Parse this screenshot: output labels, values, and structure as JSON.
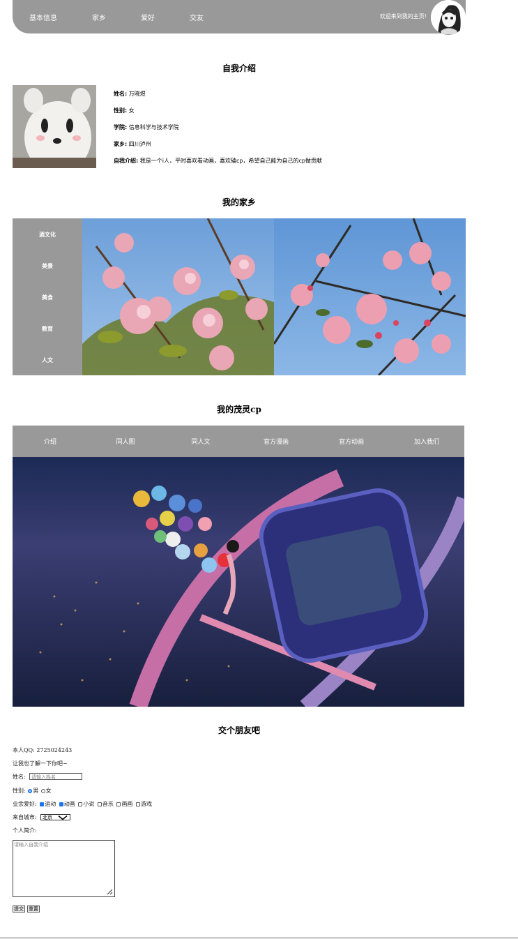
{
  "nav": {
    "links": [
      "基本信息",
      "家乡",
      "爱好",
      "交友"
    ],
    "welcome": "欢迎来到我的主页!"
  },
  "intro": {
    "title": "自我介绍",
    "rows": [
      {
        "label": "姓名:",
        "value": "万晓煜"
      },
      {
        "label": "性别:",
        "value": "女"
      },
      {
        "label": "学院:",
        "value": "信息科学与技术学院"
      },
      {
        "label": "家乡:",
        "value": "四川泸州"
      },
      {
        "label": "自我介绍:",
        "value": "我是一个i人，平时喜欢看动画，喜欢磕cp，希望自己能为自己的cp做贡献"
      }
    ]
  },
  "hometown": {
    "title": "我的家乡",
    "menu": [
      "酒文化",
      "美景",
      "美食",
      "教育",
      "人文"
    ]
  },
  "cp": {
    "title": "我的茂灵cp",
    "tabs": [
      "介绍",
      "同人图",
      "同人文",
      "官方漫画",
      "官方动画",
      "加入我们"
    ]
  },
  "friend": {
    "title": "交个朋友吧",
    "qq_label": "本人QQ:",
    "qq_value": "2725024243",
    "prompt": "让我也了解一下你吧~",
    "name_label": "姓名:",
    "name_placeholder": "请输入姓名",
    "gender_label": "性别:",
    "gender_options": [
      "男",
      "女"
    ],
    "gender_selected": "男",
    "hobby_label": "业余爱好:",
    "hobbies": [
      {
        "label": "运动",
        "checked": true
      },
      {
        "label": "动画",
        "checked": true
      },
      {
        "label": "小说",
        "checked": false
      },
      {
        "label": "音乐",
        "checked": false
      },
      {
        "label": "画画",
        "checked": false
      },
      {
        "label": "游戏",
        "checked": false
      }
    ],
    "city_label": "来自城市:",
    "city_value": "北京",
    "bio_label": "个人简介:",
    "bio_placeholder": "请输入自我介绍",
    "submit_label": "提交",
    "reset_label": "重置"
  }
}
